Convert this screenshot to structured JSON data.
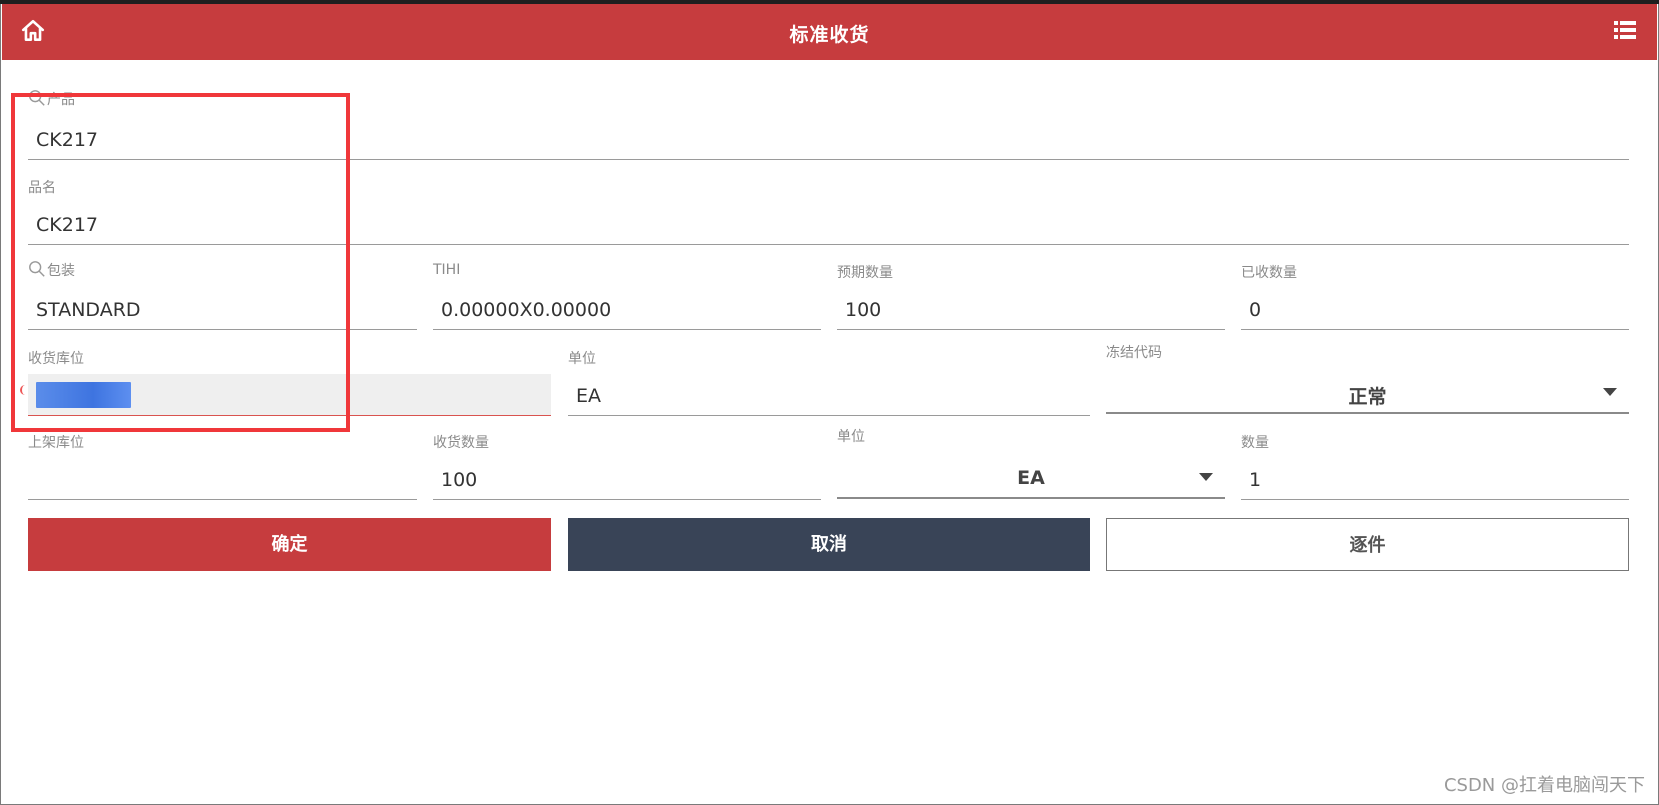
{
  "header": {
    "title": "标准收货",
    "home_icon": "home-icon",
    "menu_icon": "menu-list-icon",
    "color": "#c63c3e"
  },
  "form": {
    "product": {
      "label": "产品",
      "value": "CK217"
    },
    "product_name": {
      "label": "品名",
      "value": "CK217"
    },
    "packaging": {
      "label": "包装",
      "value": "STANDARD"
    },
    "tihi": {
      "label": "TIHI",
      "value": "0.00000X0.00000"
    },
    "expected_qty": {
      "label": "预期数量",
      "value": "100"
    },
    "received_qty": {
      "label": "已收数量",
      "value": "0"
    },
    "receiving_location": {
      "label": "收货库位",
      "value": ""
    },
    "unit": {
      "label": "单位",
      "value": "EA"
    },
    "freeze_code": {
      "label": "冻结代码",
      "value": "正常"
    },
    "putaway_location": {
      "label": "上架库位",
      "value": ""
    },
    "receive_qty": {
      "label": "收货数量",
      "value": "100"
    },
    "receive_unit": {
      "label": "单位",
      "value": "EA"
    },
    "quantity": {
      "label": "数量",
      "value": "1"
    }
  },
  "buttons": {
    "confirm": "确定",
    "cancel": "取消",
    "piece_by_piece": "逐件"
  },
  "watermark": "CSDN @扛着电脑闯天下",
  "colors": {
    "accent": "#c63c3e",
    "dark_button": "#394457",
    "annotation_box": "#f0373a"
  }
}
